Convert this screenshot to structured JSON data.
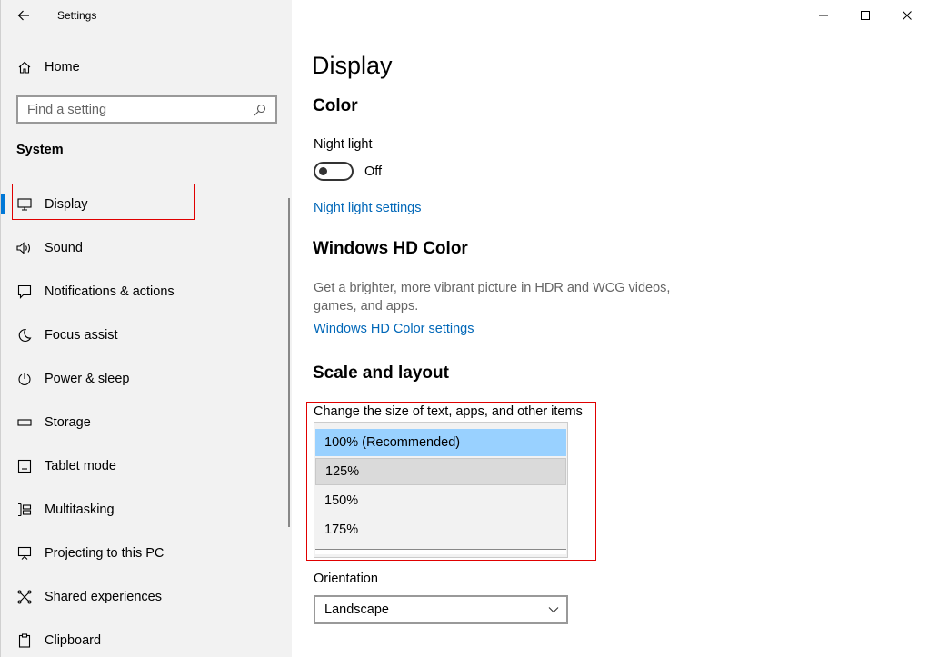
{
  "window": {
    "title": "Settings"
  },
  "sidebar": {
    "home_label": "Home",
    "search_placeholder": "Find a setting",
    "section_label": "System",
    "items": [
      {
        "label": "Display",
        "icon": "monitor-icon"
      },
      {
        "label": "Sound",
        "icon": "speaker-icon"
      },
      {
        "label": "Notifications & actions",
        "icon": "notification-icon"
      },
      {
        "label": "Focus assist",
        "icon": "moon-icon"
      },
      {
        "label": "Power & sleep",
        "icon": "power-icon"
      },
      {
        "label": "Storage",
        "icon": "storage-icon"
      },
      {
        "label": "Tablet mode",
        "icon": "tablet-icon"
      },
      {
        "label": "Multitasking",
        "icon": "multitasking-icon"
      },
      {
        "label": "Projecting to this PC",
        "icon": "projecting-icon"
      },
      {
        "label": "Shared experiences",
        "icon": "shared-icon"
      },
      {
        "label": "Clipboard",
        "icon": "clipboard-icon"
      }
    ]
  },
  "main": {
    "title": "Display",
    "color_heading": "Color",
    "night_light_label": "Night light",
    "night_light_state": "Off",
    "night_light_link": "Night light settings",
    "hd_heading": "Windows HD Color",
    "hd_description": "Get a brighter, more vibrant picture in HDR and WCG videos, games, and apps.",
    "hd_link": "Windows HD Color settings",
    "scale_heading": "Scale and layout",
    "scale_label": "Change the size of text, apps, and other items",
    "scale_options": [
      "100% (Recommended)",
      "125%",
      "150%",
      "175%"
    ],
    "orientation_label": "Orientation",
    "orientation_value": "Landscape"
  },
  "colors": {
    "accent": "#0078d7",
    "link": "#0067b8",
    "highlight": "#e00000",
    "selected_option": "#99d1ff"
  }
}
